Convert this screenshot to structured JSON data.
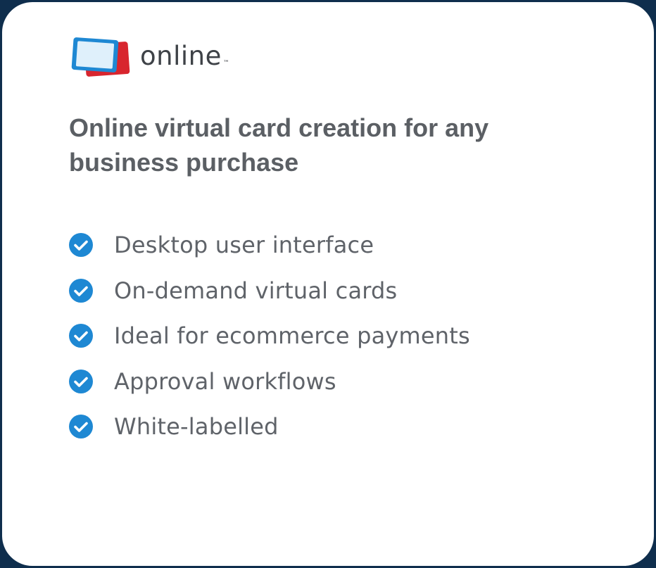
{
  "brand": {
    "logo_text": "online",
    "logo_mark": "™",
    "colors": {
      "card_back": "#d8252e",
      "card_front": "#1e88d3",
      "card_inner": "#dff0fb",
      "background": "#0f2e4d",
      "check": "#1e88d3"
    }
  },
  "headline": "Online virtual card creation for any business purchase",
  "features": [
    {
      "label": "Desktop user interface",
      "icon": "check-circle-icon"
    },
    {
      "label": "On-demand virtual cards",
      "icon": "check-circle-icon"
    },
    {
      "label": "Ideal for ecommerce payments",
      "icon": "check-circle-icon"
    },
    {
      "label": "Approval workflows",
      "icon": "check-circle-icon"
    },
    {
      "label": "White-labelled",
      "icon": "check-circle-icon"
    }
  ]
}
